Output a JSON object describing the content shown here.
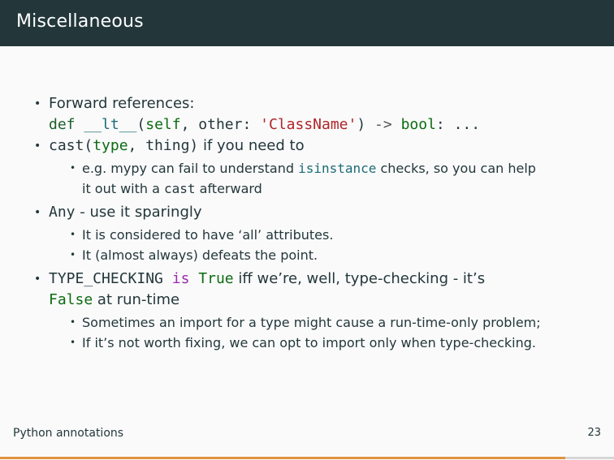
{
  "slide": {
    "title": "Miscellaneous",
    "footer": "Python annotations",
    "page_number": "23",
    "progress_fraction": 0.92
  },
  "bullets": {
    "b1": {
      "text": "Forward references:",
      "code": {
        "def": "def",
        "name": "__lt__",
        "open": "(",
        "self": "self",
        "comma_other": ", other: ",
        "str": "'ClassName'",
        "close": ")",
        "arrow": " -> ",
        "bool": "bool",
        "tail": ": ..."
      }
    },
    "b2": {
      "cast": "cast(",
      "type": "type",
      "rest": ", thing)",
      "text": " if you need to",
      "sub1": {
        "pre": "e.g. mypy can fail to understand ",
        "code1": "isinstance",
        "mid": " checks, so you can help",
        "line2": "it out with a ",
        "code2": "cast",
        "post": " afterward"
      }
    },
    "b3": {
      "code": "Any",
      "text": " - use it sparingly",
      "sub1": "It is considered to have ‘all’ attributes.",
      "sub2": "It (almost always) defeats the point."
    },
    "b4": {
      "code1": "TYPE_CHECKING",
      "is": "is",
      "true": "True",
      "text1": " iff we’re, well, type-checking - it’s",
      "false": "False",
      "text2": " at run-time",
      "sub1": "Sometimes an import for a type might cause a run-time-only problem;",
      "sub2": "If it’s not worth fixing, we can opt to import only when type-checking."
    },
    "bullet_glyph": "•"
  },
  "colors": {
    "header_bg": "#23373b",
    "accent_progress": "#e0923e"
  }
}
